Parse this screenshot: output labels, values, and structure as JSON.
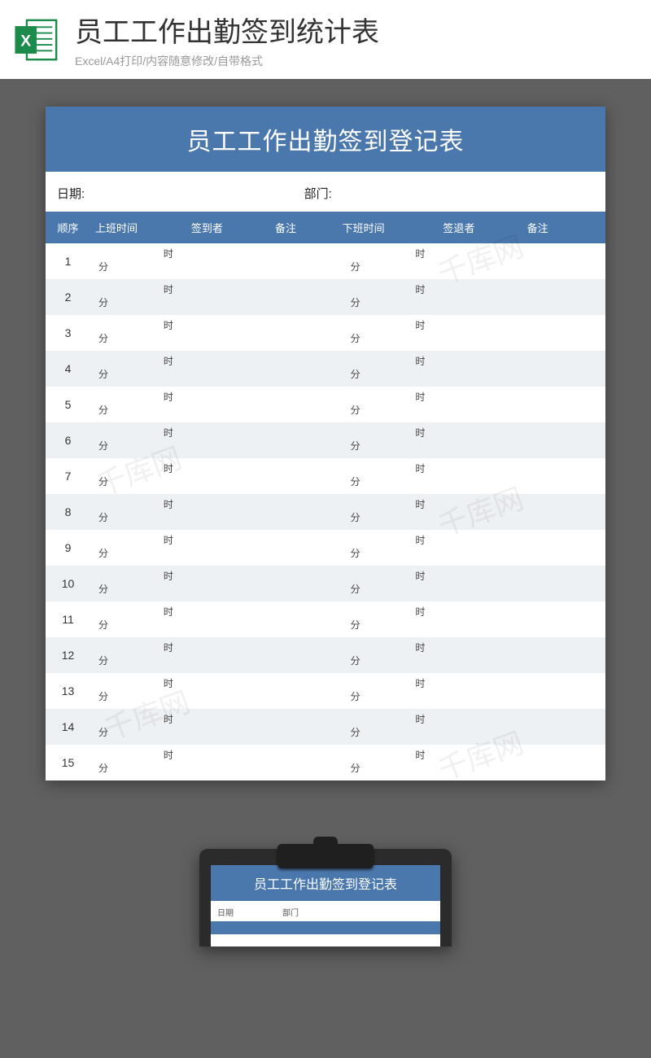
{
  "header": {
    "title": "员工工作出勤签到统计表",
    "subtitle": "Excel/A4打印/内容随意修改/自带格式"
  },
  "sheet": {
    "title": "员工工作出勤签到登记表",
    "date_label": "日期:",
    "dept_label": "部门:",
    "columns": {
      "seq": "顺序",
      "on_time": "上班时间",
      "signer": "签到者",
      "note": "备注",
      "off_time": "下班时间",
      "signout": "签退者",
      "note2": "备注"
    },
    "time_units": {
      "hour": "时",
      "minute": "分"
    },
    "row_count": 15
  },
  "thumb": {
    "title": "员工工作出勤签到登记表",
    "date_label": "日期",
    "dept_label": "部门"
  },
  "watermark": "千库网"
}
